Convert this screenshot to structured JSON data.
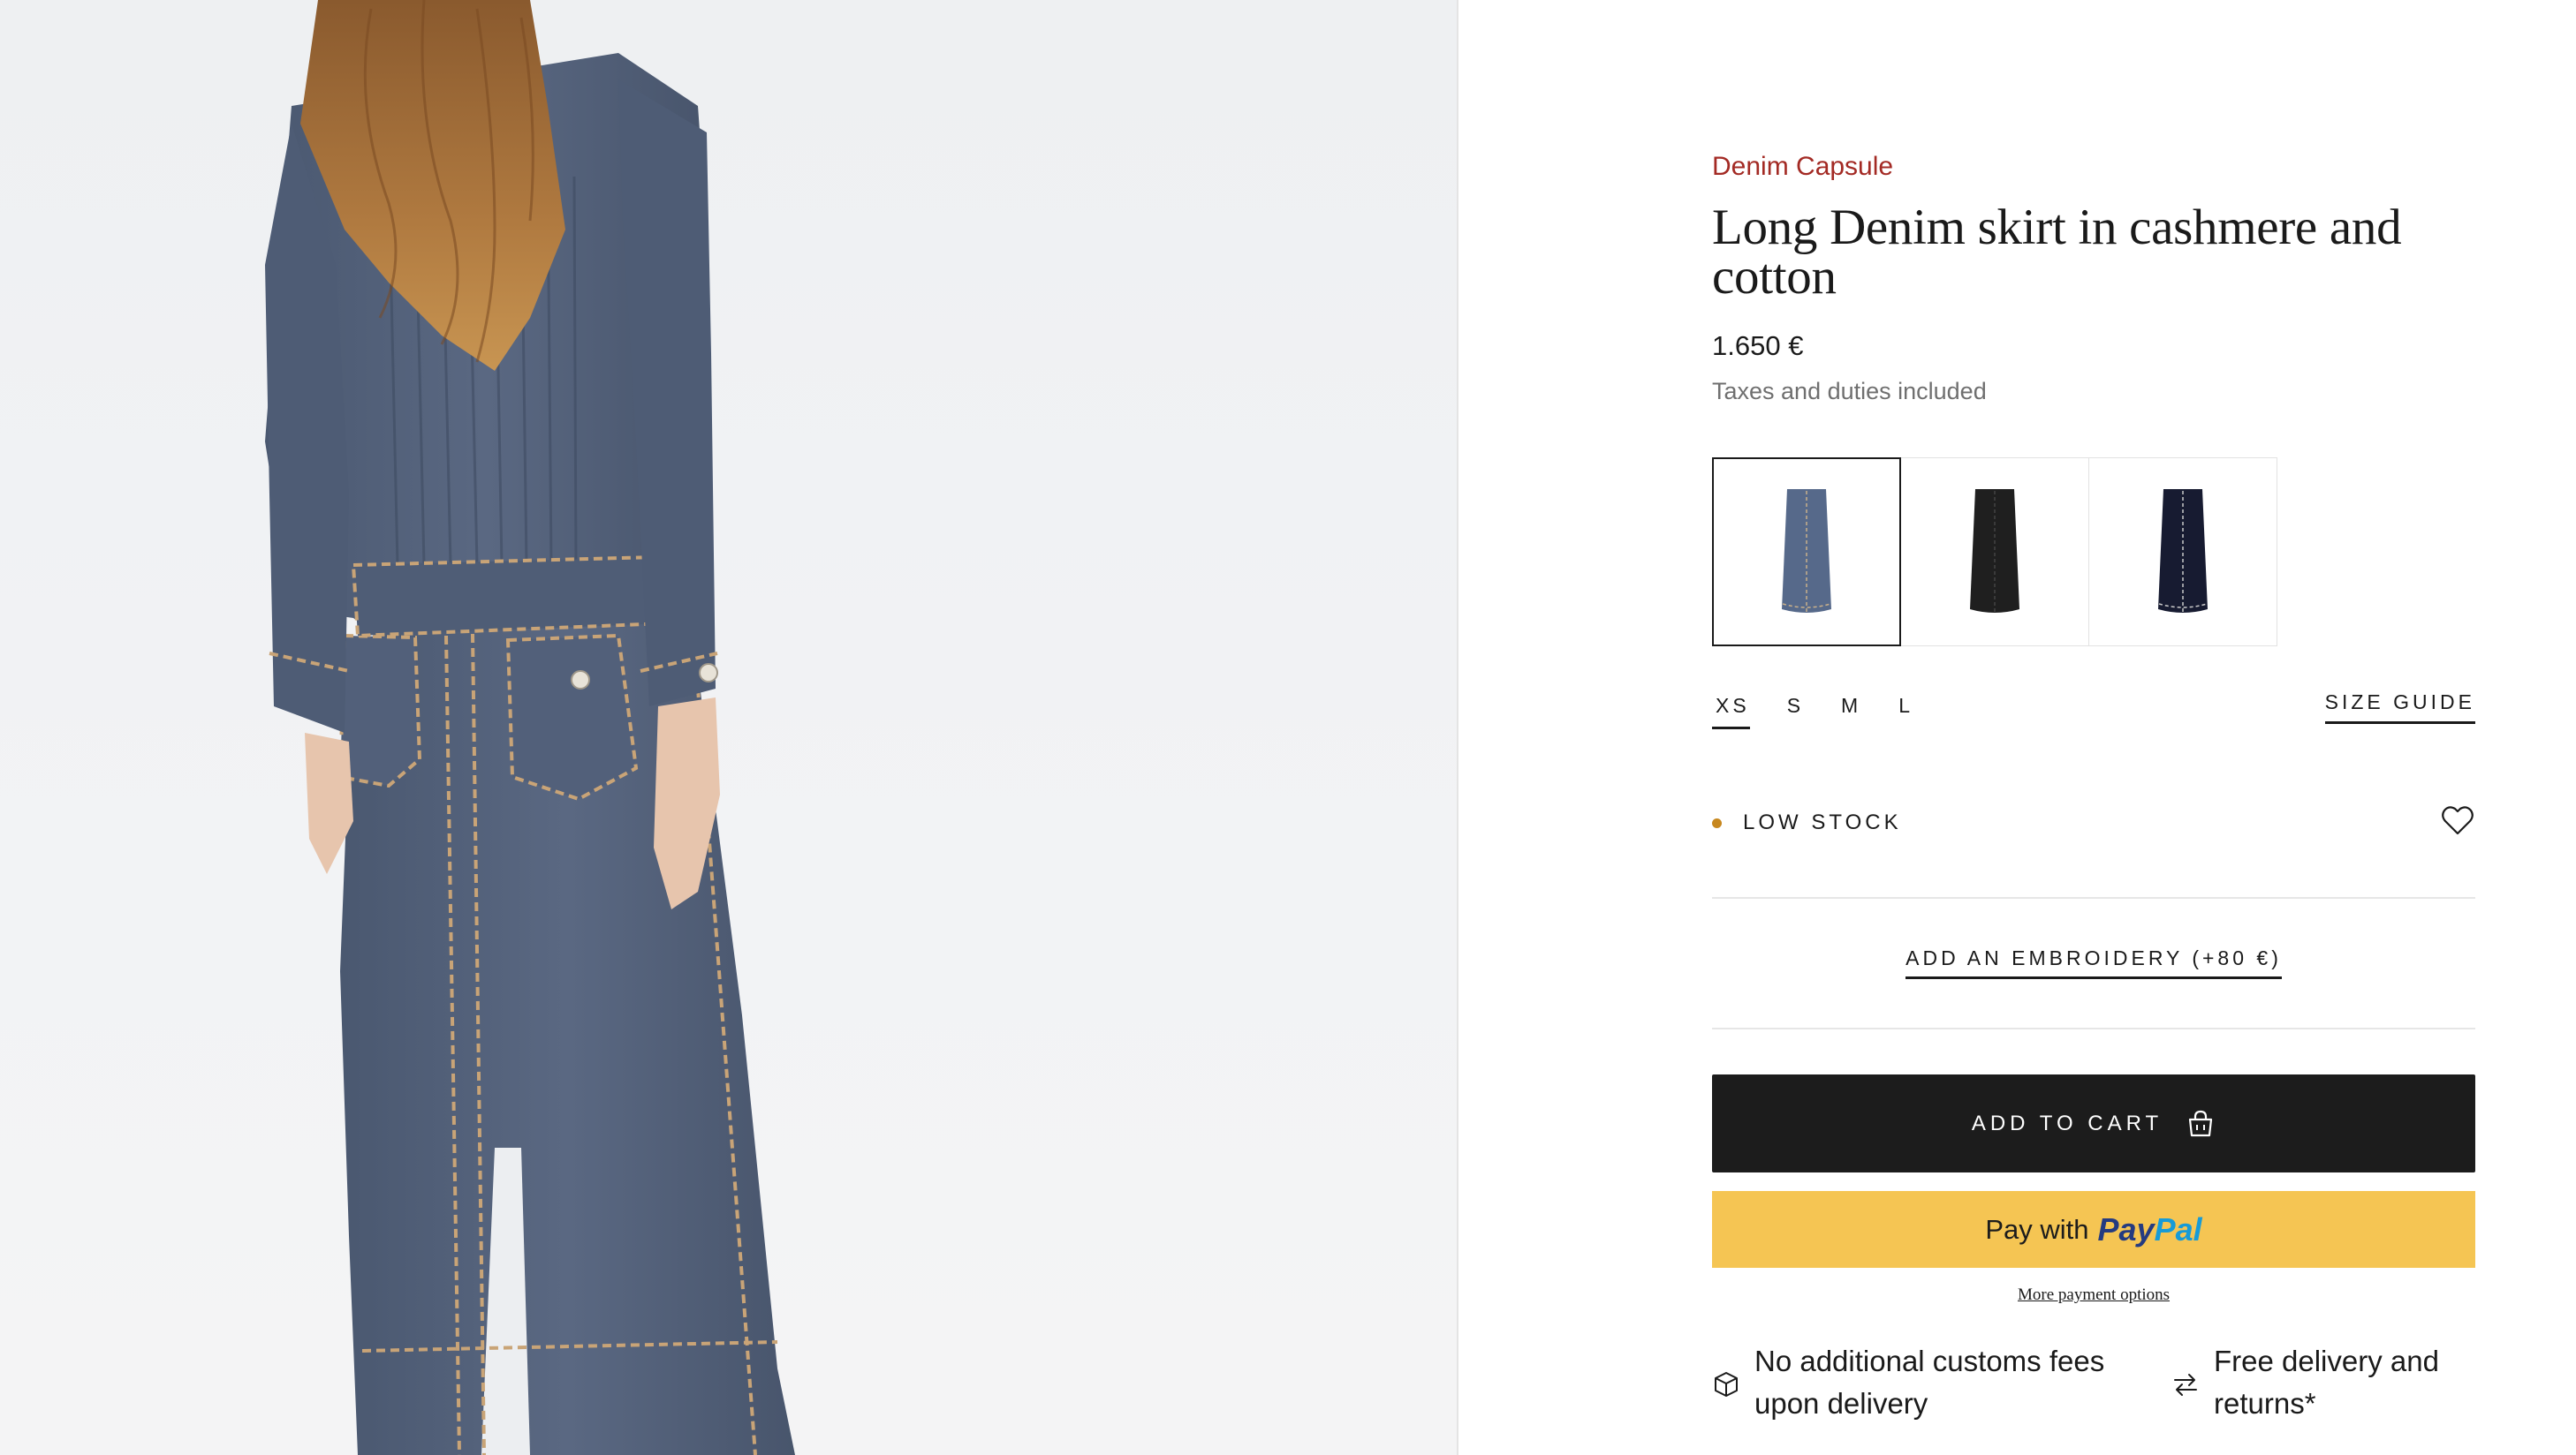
{
  "product": {
    "collection": "Denim Capsule",
    "title": "Long Denim skirt in cashmere and cotton",
    "price": "1.650 €",
    "taxes_note": "Taxes and duties included"
  },
  "swatches": [
    {
      "color_name": "denim-blue",
      "color": "#56698a",
      "selected": true
    },
    {
      "color_name": "black",
      "color": "#1f1f1f",
      "selected": false
    },
    {
      "color_name": "navy",
      "color": "#171b31",
      "selected": false
    }
  ],
  "sizes": {
    "options": [
      "XS",
      "S",
      "M",
      "L"
    ],
    "selected": "XS",
    "guide_label": "SIZE GUIDE"
  },
  "stock": {
    "label": "LOW STOCK",
    "dot_color": "#c7871e"
  },
  "embroidery": {
    "label": "ADD AN EMBROIDERY (+80 €)"
  },
  "cart": {
    "label": "ADD TO CART",
    "icon": "shopping-bag-icon"
  },
  "paypal": {
    "prefix": "Pay with",
    "brand_pay": "Pay",
    "brand_pal": "Pal",
    "more_options": "More payment options"
  },
  "benefits": [
    {
      "icon": "box-icon",
      "text": "No additional customs fees upon delivery"
    },
    {
      "icon": "exchange-arrows-icon",
      "text": "Free delivery and returns*"
    }
  ],
  "colors": {
    "accent": "#a32a24",
    "button_dark": "#1c1c1c",
    "paypal_yellow": "#f5c553",
    "paypal_navy": "#253b80",
    "paypal_blue": "#179bd7"
  }
}
